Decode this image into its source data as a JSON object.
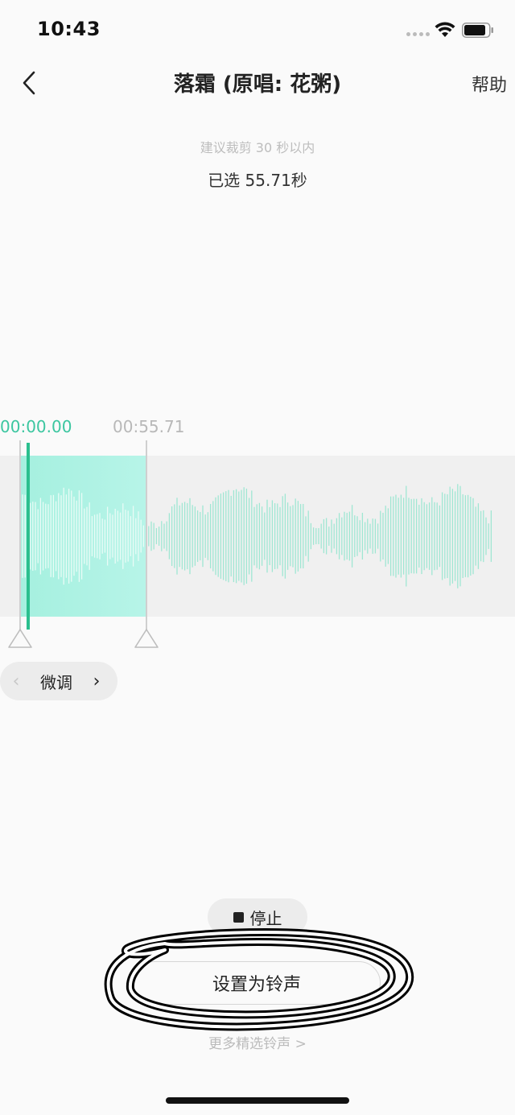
{
  "status_bar": {
    "time": "10:43"
  },
  "nav": {
    "title": "落霜 (原唱: 花粥)",
    "help_label": "帮助"
  },
  "trim": {
    "hint": "建议裁剪 30 秒以内",
    "selected_text": "已选 55.71秒",
    "start_time": "00:00.00",
    "end_time": "00:55.71"
  },
  "fine_tune": {
    "label": "微调",
    "prev_glyph": "‹",
    "next_glyph": "›"
  },
  "player": {
    "stop_label": "停止"
  },
  "actions": {
    "set_ringtone_label": "设置为铃声",
    "more_label": "更多精选铃声 >"
  },
  "colors": {
    "accent": "#3cc6a0",
    "playhead": "#2bbf8e",
    "selection_fill": "#b0f2e4",
    "waveform": "#9fe6d3"
  }
}
